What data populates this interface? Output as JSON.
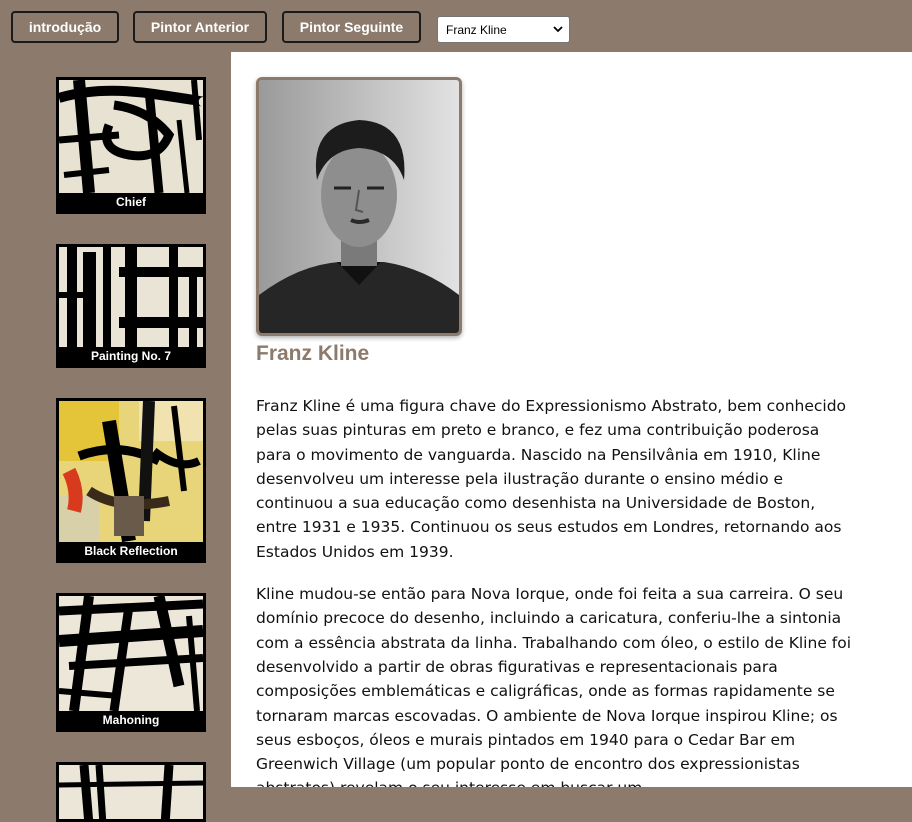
{
  "nav": {
    "intro_label": "introdução",
    "prev_label": "Pintor Anterior",
    "next_label": "Pintor Seguinte",
    "painter_select_value": "Franz Kline"
  },
  "sidebar": {
    "paintings": [
      {
        "title": "Chief"
      },
      {
        "title": "Painting No. 7"
      },
      {
        "title": "Black Reflection"
      },
      {
        "title": "Mahoning"
      },
      {
        "title": ""
      }
    ]
  },
  "painter": {
    "name": "Franz Kline",
    "bio": [
      "Franz Kline é uma figura chave do Expressionismo Abstrato, bem conhecido pelas suas pinturas em preto e branco, e fez uma contribuição poderosa para o movimento de vanguarda. Nascido na Pensilvânia em 1910, Kline desenvolveu um interesse pela ilustração durante o ensino médio e continuou a sua educação como desenhista na Universidade de Boston, entre 1931 e 1935. Continuou os seus estudos em Londres, retornando aos Estados Unidos em 1939.",
      "Kline mudou-se então para Nova Iorque, onde foi feita a sua carreira. O seu domínio precoce do desenho, incluindo a caricatura, conferiu-lhe a sintonia com a essência abstrata da linha. Trabalhando com óleo, o estilo de Kline foi desenvolvido a partir de obras figurativas e representacionais para composições emblemáticas e caligráficas, onde as formas rapidamente se tornaram marcas escovadas. O ambiente de Nova Iorque inspirou Kline; os seus esboços, óleos e murais pintados em 1940 para o Cedar Bar em Greenwich Village (um popular ponto de encontro dos expressionistas abstratos) revelam o seu interesse em buscar um"
    ]
  },
  "colors": {
    "background": "#8c7b6c",
    "accent": "#8c7b6c",
    "content_bg": "#ffffff"
  }
}
